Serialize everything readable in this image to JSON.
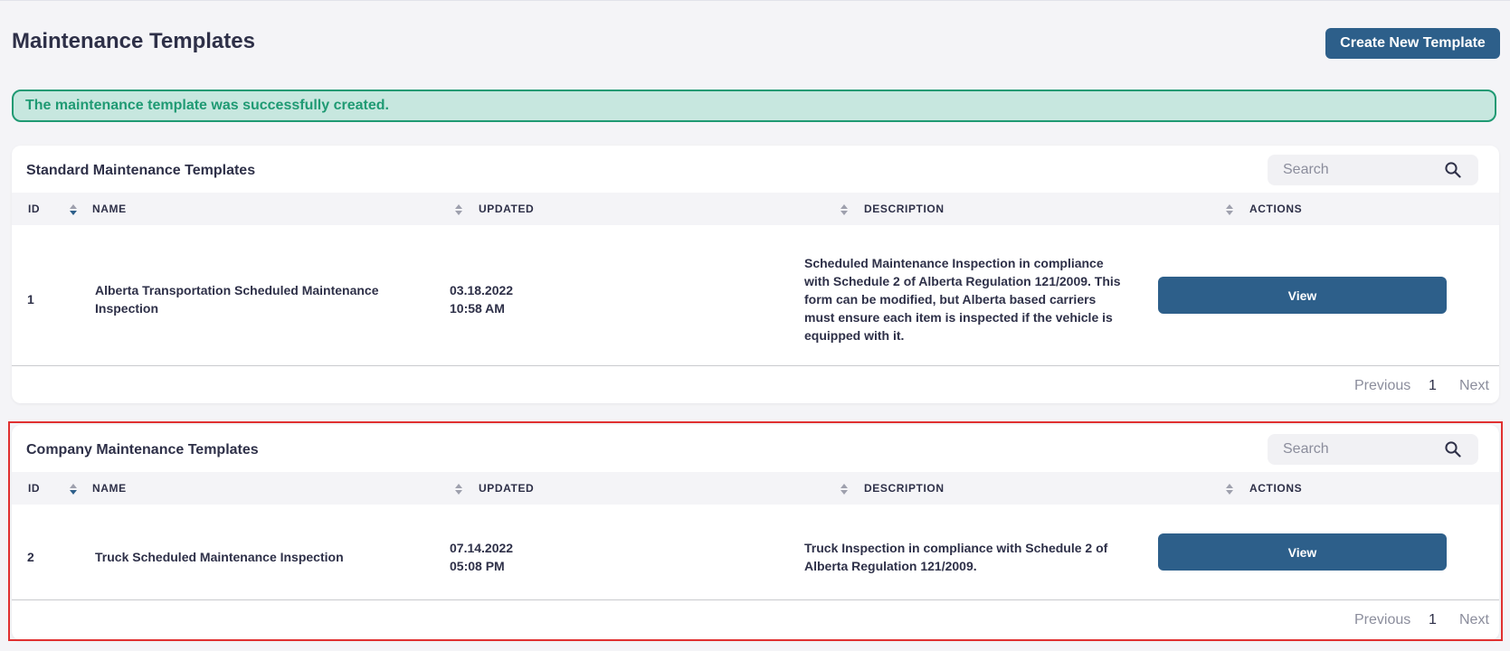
{
  "page": {
    "title": "Maintenance Templates",
    "create_button": "Create New Template"
  },
  "alert": {
    "message": "The maintenance template was successfully created."
  },
  "standard": {
    "title": "Standard Maintenance Templates",
    "search_placeholder": "Search",
    "columns": [
      "ID",
      "NAME",
      "UPDATED",
      "DESCRIPTION",
      "ACTIONS"
    ],
    "rows": [
      {
        "id": "1",
        "name": "Alberta Transportation Scheduled Maintenance Inspection",
        "updated_date": "03.18.2022",
        "updated_time": "10:58 AM",
        "description": "Scheduled Maintenance Inspection in compliance with Schedule 2 of Alberta Regulation 121/2009. This form can be modified, but Alberta based carriers must ensure each item is inspected if the vehicle is equipped with it.",
        "action": "View"
      }
    ],
    "pagination": {
      "previous": "Previous",
      "page": "1",
      "next": "Next"
    }
  },
  "company": {
    "title": "Company Maintenance Templates",
    "search_placeholder": "Search",
    "columns": [
      "ID",
      "NAME",
      "UPDATED",
      "DESCRIPTION",
      "ACTIONS"
    ],
    "rows": [
      {
        "id": "2",
        "name": "Truck Scheduled Maintenance Inspection",
        "updated_date": "07.14.2022",
        "updated_time": "05:08 PM",
        "description": "Truck Inspection in compliance with Schedule 2 of Alberta Regulation 121/2009.",
        "action": "View"
      }
    ],
    "pagination": {
      "previous": "Previous",
      "page": "1",
      "next": "Next"
    }
  },
  "icons": {
    "search": "search-icon",
    "sort": "sort-icon"
  },
  "colors": {
    "primary": "#2d5f8a",
    "success_text": "#1f9a73",
    "success_bg": "#c7e7df",
    "highlight": "#e03030"
  }
}
